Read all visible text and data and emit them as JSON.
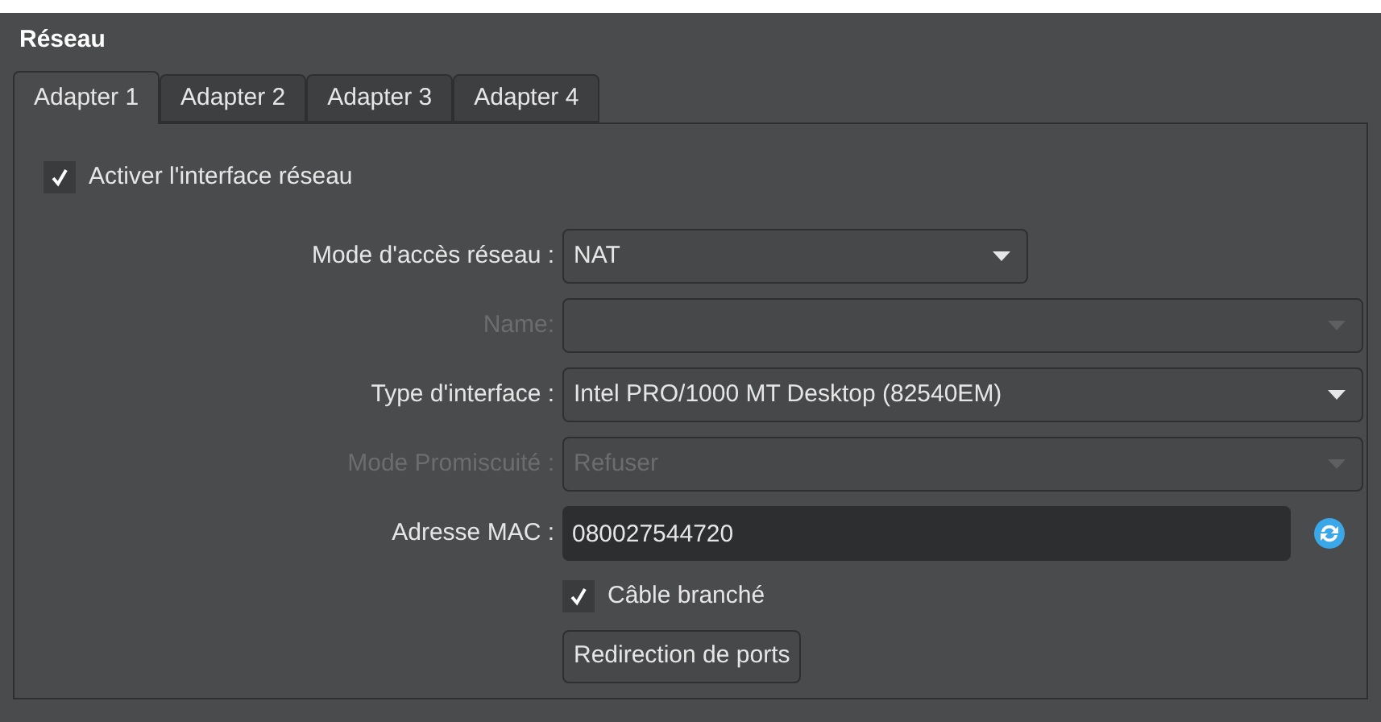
{
  "section_title": "Réseau",
  "tabs": [
    {
      "label": "Adapter 1",
      "selected": true
    },
    {
      "label": "Adapter 2",
      "selected": false
    },
    {
      "label": "Adapter 3",
      "selected": false
    },
    {
      "label": "Adapter 4",
      "selected": false
    }
  ],
  "enable_adapter": {
    "label": "Activer l'interface réseau",
    "checked": true
  },
  "fields": [
    {
      "kind": "select",
      "label": "Mode d'accès réseau :",
      "value": "NAT",
      "disabled": false,
      "wide": false
    },
    {
      "kind": "select",
      "label": "Name:",
      "disabled": true,
      "wide": true
    },
    {
      "kind": "select",
      "label": "Type d'interface :",
      "value": "Intel PRO/1000 MT Desktop (82540EM)",
      "disabled": false,
      "wide": true
    },
    {
      "kind": "select",
      "label": "Mode Promiscuité :",
      "value": "Refuser",
      "disabled": true,
      "wide": true
    },
    {
      "kind": "text",
      "label": "Adresse MAC :",
      "value": "080027544720",
      "disabled": false
    }
  ],
  "cable_connected": {
    "label": "Câble branché",
    "checked": true
  },
  "port_forwarding_button": "Redirection de ports"
}
